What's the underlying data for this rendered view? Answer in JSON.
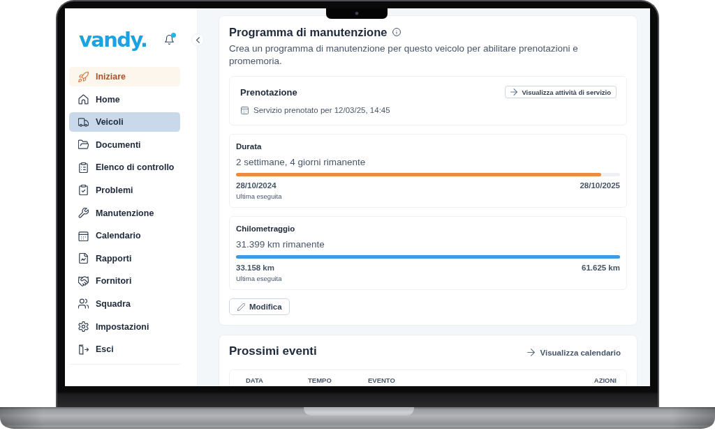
{
  "sidebar": {
    "logo": "vandy.",
    "notifications": {
      "unread": true
    },
    "items": [
      {
        "label": "Iniziare",
        "kind": "promo",
        "selected": false
      },
      {
        "label": "Home",
        "kind": "link",
        "selected": false
      },
      {
        "label": "Veicoli",
        "kind": "link",
        "selected": true
      },
      {
        "label": "Documenti",
        "kind": "link",
        "selected": false
      },
      {
        "label": "Elenco di controllo",
        "kind": "link",
        "selected": false
      },
      {
        "label": "Problemi",
        "kind": "link",
        "selected": false
      },
      {
        "label": "Manutenzione",
        "kind": "link",
        "selected": false
      },
      {
        "label": "Calendario",
        "kind": "link",
        "selected": false
      },
      {
        "label": "Rapporti",
        "kind": "link",
        "selected": false
      },
      {
        "label": "Fornitori",
        "kind": "link",
        "selected": false
      },
      {
        "label": "Squadra",
        "kind": "link",
        "selected": false
      },
      {
        "label": "Impostazioni",
        "kind": "link",
        "selected": false
      },
      {
        "label": "Esci",
        "kind": "link",
        "selected": false
      }
    ]
  },
  "maintenance_program": {
    "title": "Programma di manutenzione",
    "description": "Crea un programma di manutenzione per questo veicolo per abilitare prenotazioni e promemoria.",
    "booking": {
      "title": "Prenotazione",
      "action": "Visualizza attività di servizio",
      "detail": "Servizio prenotato per 12/03/25, 14:45"
    },
    "meters": [
      {
        "title": "Durata",
        "remaining": "2 settimane, 4 giorni rimanente",
        "level": 0.95,
        "color": "#ec8a3e",
        "start": "28/10/2024",
        "end": "28/10/2025",
        "caption": "Ultima eseguita"
      },
      {
        "title": "Chilometraggio",
        "remaining": "31.399 km rimanente",
        "level": 1,
        "color": "#4299e1",
        "start": "33.158 km",
        "end": "61.625 km",
        "caption": "Ultima eseguita"
      }
    ],
    "edit_button": "Modifica"
  },
  "upcoming_events": {
    "title": "Prossimi eventi",
    "calendar_link": "Visualizza calendario",
    "columns": [
      "DATA",
      "TEMPO",
      "EVENTO",
      "AZIONI"
    ]
  }
}
